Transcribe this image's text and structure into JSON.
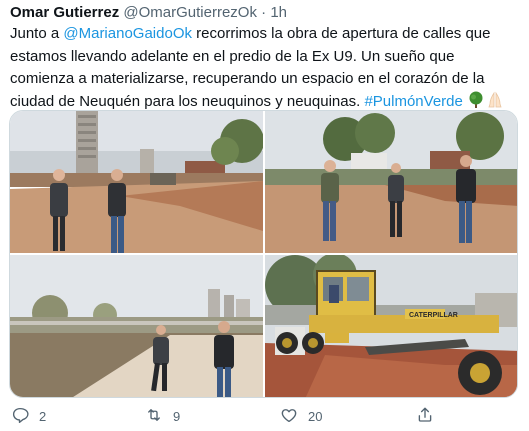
{
  "tweet": {
    "author_name": "Omar Gutierrez",
    "author_handle": "@OmarGutierrezOk",
    "separator": "·",
    "time": "1h",
    "text": {
      "p1": "Junto a ",
      "mention": "@MarianoGaidoOk",
      "p2": " recorrimos la obra de apertura de calles que estamos llevando adelante en el predio de la Ex U9. Un sueño que comienza a materializarse, recuperando un espacio en el corazón de la ciudad de Neuquén para los neuquinos y neuquinas. ",
      "hashtag": "#PulmónVerde",
      "emojis": [
        "tree-emoji",
        "praying-hands-emoji"
      ]
    },
    "media": {
      "photo1_sign": "",
      "photo4_machine_label": "CATERPILLAR"
    },
    "actions": {
      "reply_count": "2",
      "retweet_count": "9",
      "like_count": "20",
      "share_icon": "share-icon"
    }
  },
  "colors": {
    "link": "#1b95e0",
    "secondary_text": "#536471",
    "primary_text": "#0f1419"
  }
}
